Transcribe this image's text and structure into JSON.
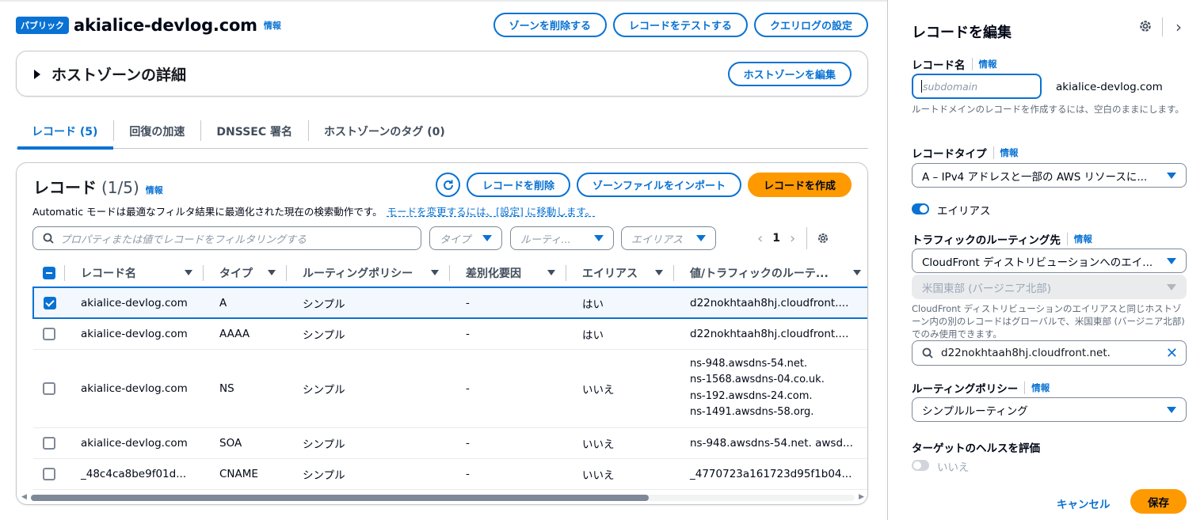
{
  "header": {
    "badge": "パブリック",
    "zone_name": "akialice-devlog.com",
    "info": "情報",
    "buttons": {
      "delete_zone": "ゾーンを削除する",
      "test_record": "レコードをテストする",
      "query_log": "クエリログの設定"
    }
  },
  "details": {
    "title": "ホストゾーンの詳細",
    "edit_button": "ホストゾーンを編集"
  },
  "tabs": [
    {
      "label": "レコード (5)",
      "active": true
    },
    {
      "label": "回復の加速",
      "active": false
    },
    {
      "label": "DNSSEC 署名",
      "active": false
    },
    {
      "label": "ホストゾーンのタグ (0)",
      "active": false
    }
  ],
  "records": {
    "title": "レコード",
    "count": "(1/5)",
    "info": "情報",
    "delete_button": "レコードを削除",
    "import_button": "ゾーンファイルをインポート",
    "create_button": "レコードを作成",
    "auto_note": "Automatic モードは最適なフィルタ結果に最適化された現在の検索動作です。",
    "auto_link": "モードを変更するには、[設定] に移動します。",
    "search_placeholder": "プロパティまたは値でレコードをフィルタリングする",
    "filter_type": "タイプ",
    "filter_routing": "ルーティ...",
    "filter_alias": "エイリアス",
    "page": "1",
    "columns": [
      "レコード名",
      "タイプ",
      "ルーティングポリシー",
      "差別化要因",
      "エイリアス",
      "値/トラフィックのルーテ..."
    ],
    "rows": [
      {
        "name": "akialice-devlog.com",
        "type": "A",
        "policy": "シンプル",
        "diff": "-",
        "alias": "はい",
        "value": "d22nokhtaah8hj.cloudfront....",
        "checked": true
      },
      {
        "name": "akialice-devlog.com",
        "type": "AAAA",
        "policy": "シンプル",
        "diff": "-",
        "alias": "はい",
        "value": "d22nokhtaah8hj.cloudfront....",
        "checked": false
      },
      {
        "name": "akialice-devlog.com",
        "type": "NS",
        "policy": "シンプル",
        "diff": "-",
        "alias": "いいえ",
        "value_lines": [
          "ns-948.awsdns-54.net.",
          "ns-1568.awsdns-04.co.uk.",
          "ns-192.awsdns-24.com.",
          "ns-1491.awsdns-58.org."
        ],
        "checked": false
      },
      {
        "name": "akialice-devlog.com",
        "type": "SOA",
        "policy": "シンプル",
        "diff": "-",
        "alias": "いいえ",
        "value": "ns-948.awsdns-54.net. awsd...",
        "checked": false
      },
      {
        "name": "_48c4ca8be9f01d...",
        "type": "CNAME",
        "policy": "シンプル",
        "diff": "-",
        "alias": "いいえ",
        "value": "_4770723a161723d95f1b04...",
        "checked": false
      }
    ]
  },
  "panel": {
    "title": "レコードを編集",
    "record_name_label": "レコード名",
    "info": "情報",
    "record_name_placeholder": "subdomain",
    "domain_suffix": "akialice-devlog.com",
    "record_name_help": "ルートドメインのレコードを作成するには、空白のままにします。",
    "record_type_label": "レコードタイプ",
    "record_type_value": "A – IPv4 アドレスと一部の AWS リソースに...",
    "alias_label": "エイリアス",
    "traffic_label": "トラフィックのルーティング先",
    "traffic_target": "CloudFront ディストリビューションへのエイ...",
    "region_value": "米国東部 (バージニア北部)",
    "region_help": "CloudFront ディストリビューションのエイリアスと同じホストゾーン内の別のレコードはグローバルで、米国東部 (バージニア北部) でのみ使用できます。",
    "distribution_value": "d22nokhtaah8hj.cloudfront.net.",
    "routing_policy_label": "ルーティングポリシー",
    "routing_policy_value": "シンプルルーティング",
    "health_label": "ターゲットのヘルスを評価",
    "health_value": "いいえ",
    "cancel": "キャンセル",
    "save": "保存"
  },
  "colors": {
    "accent": "#0972d3",
    "primary_button": "#ff9900",
    "border": "#c6c6cd"
  }
}
